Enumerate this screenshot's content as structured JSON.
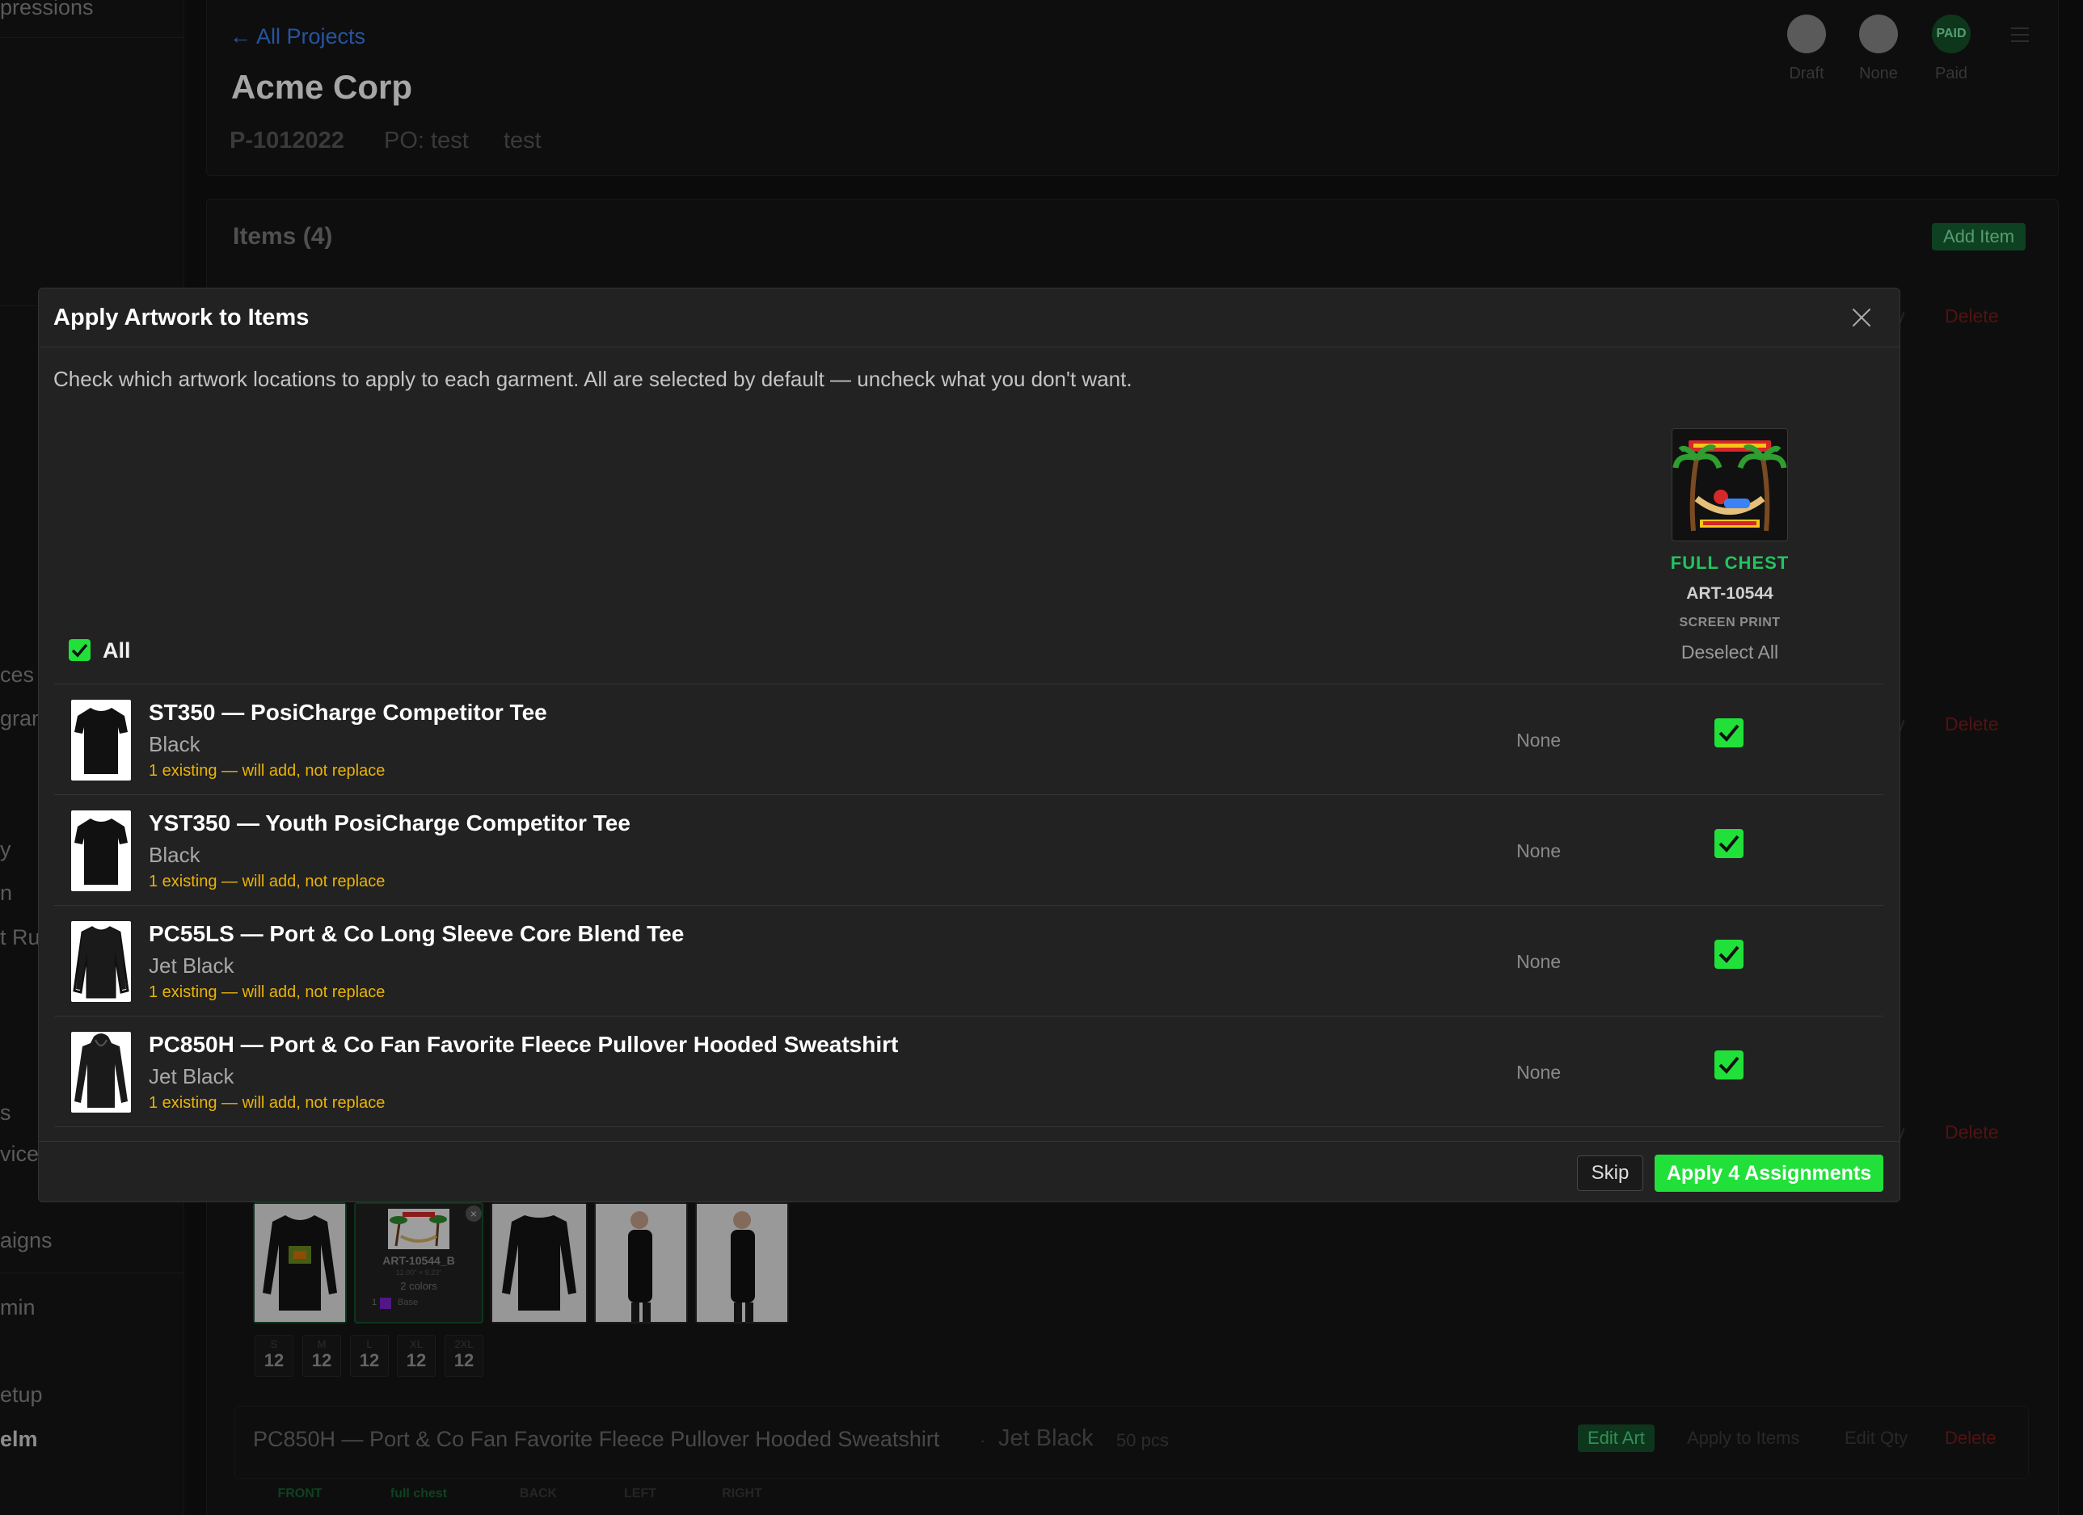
{
  "sidebar": {
    "items": [
      "pressions",
      "ces",
      "gram",
      "y",
      "n",
      "t Ru",
      "s",
      "vice",
      "aigns",
      "min",
      "etup",
      "elm"
    ]
  },
  "header": {
    "back_link": "← All Projects",
    "title": "Acme Corp",
    "project_id": "P-1012022",
    "po": "PO: test",
    "extra": "test",
    "statuses": [
      {
        "label": "Draft"
      },
      {
        "label": "None"
      },
      {
        "label": "Paid",
        "badge": "PAID"
      }
    ]
  },
  "items_section": {
    "title": "Items (4)",
    "add_button": "Add Item",
    "delete_label": "Delete",
    "faint_label": "y",
    "sizes": [
      {
        "size": "S",
        "qty": "12"
      },
      {
        "size": "M",
        "qty": "12"
      },
      {
        "size": "L",
        "qty": "12"
      },
      {
        "size": "XL",
        "qty": "12"
      },
      {
        "size": "2XL",
        "qty": "12"
      }
    ],
    "art_card": {
      "id": "ART-10544_B",
      "dims": "12.00\" × 9.23\"",
      "colors": "2 colors",
      "base": "Base",
      "count": "1"
    },
    "last_item": {
      "title": "PC850H — Port & Co Fan Favorite Fleece Pullover Hooded Sweatshirt",
      "color": "Jet Black",
      "qty": "50 pcs",
      "edit_art": "Edit Art",
      "apply_items": "Apply to Items",
      "edit_qty": "Edit Qty",
      "delete": "Delete",
      "locations": [
        "FRONT",
        "full chest",
        "BACK",
        "LEFT",
        "RIGHT"
      ]
    }
  },
  "modal": {
    "title": "Apply Artwork to Items",
    "description": "Check which artwork locations to apply to each garment. All are selected by default — uncheck what you don't want.",
    "select_all_label": "All",
    "artwork": {
      "location": "FULL CHEST",
      "id": "ART-10544",
      "method": "SCREEN PRINT",
      "deselect_label": "Deselect All"
    },
    "rows": [
      {
        "name": "ST350 — PosiCharge Competitor Tee",
        "color": "Black",
        "note": "1 existing — will add, not replace",
        "current": "None",
        "checked": true
      },
      {
        "name": "YST350 — Youth PosiCharge Competitor Tee",
        "color": "Black",
        "note": "1 existing — will add, not replace",
        "current": "None",
        "checked": true
      },
      {
        "name": "PC55LS — Port & Co Long Sleeve Core Blend Tee",
        "color": "Jet Black",
        "note": "1 existing — will add, not replace",
        "current": "None",
        "checked": true
      },
      {
        "name": "PC850H — Port & Co Fan Favorite Fleece Pullover Hooded Sweatshirt",
        "color": "Jet Black",
        "note": "1 existing — will add, not replace",
        "current": "None",
        "checked": true
      }
    ],
    "skip_label": "Skip",
    "apply_label": "Apply 4 Assignments"
  },
  "colors": {
    "accent_green": "#22e03a",
    "warning_yellow": "#eab308",
    "danger_red": "#7f1d1d",
    "link_blue": "#3b82f6"
  }
}
